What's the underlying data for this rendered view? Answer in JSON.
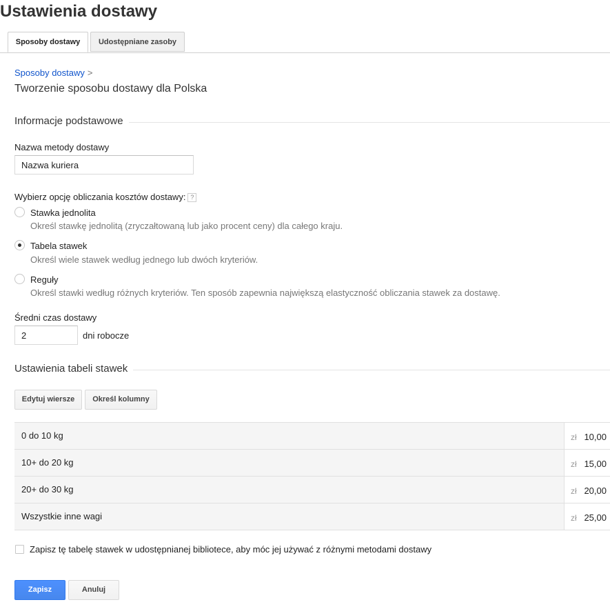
{
  "page": {
    "title": "Ustawienia dostawy"
  },
  "tabs": [
    {
      "label": "Sposoby dostawy",
      "active": true
    },
    {
      "label": "Udostępniane zasoby",
      "active": false
    }
  ],
  "breadcrumb": {
    "link": "Sposoby dostawy",
    "separator": ">"
  },
  "subtitle": "Tworzenie sposobu dostawy dla Polska",
  "basic_info": {
    "heading": "Informacje podstawowe",
    "method_name_label": "Nazwa metody dostawy",
    "method_name_value": "Nazwa kuriera",
    "calc_option_label": "Wybierz opcję obliczania kosztów dostawy:",
    "help_icon_text": "?",
    "options": [
      {
        "label": "Stawka jednolita",
        "description": "Określ stawkę jednolitą (zryczałtowaną lub jako procent ceny) dla całego kraju.",
        "selected": false
      },
      {
        "label": "Tabela stawek",
        "description": "Określ wiele stawek według jednego lub dwóch kryteriów.",
        "selected": true
      },
      {
        "label": "Reguły",
        "description": "Określ stawki według różnych kryteriów. Ten sposób zapewnia największą elastyczność obliczania stawek za dostawę.",
        "selected": false
      }
    ],
    "avg_time_label": "Średni czas dostawy",
    "avg_time_value": "2",
    "avg_time_suffix": "dni robocze"
  },
  "rate_table": {
    "heading": "Ustawienia tabeli stawek",
    "edit_rows_button": "Edytuj wiersze",
    "define_columns_button": "Określ kolumny",
    "currency": "zł",
    "rows": [
      {
        "condition": "0 do 10 kg",
        "value": "10,00"
      },
      {
        "condition": "10+ do 20 kg",
        "value": "15,00"
      },
      {
        "condition": "20+ do 30 kg",
        "value": "20,00"
      },
      {
        "condition": "Wszystkie inne wagi",
        "value": "25,00"
      }
    ]
  },
  "save_table_checkbox": {
    "label": "Zapisz tę tabelę stawek w udostępnianej bibliotece, aby móc jej używać z różnymi metodami dostawy",
    "checked": false
  },
  "actions": {
    "save": "Zapisz",
    "cancel": "Anuluj"
  },
  "colors": {
    "link": "#1155cc",
    "primary_button": "#4d90fe",
    "table_row_bg": "#f5f5f5"
  }
}
